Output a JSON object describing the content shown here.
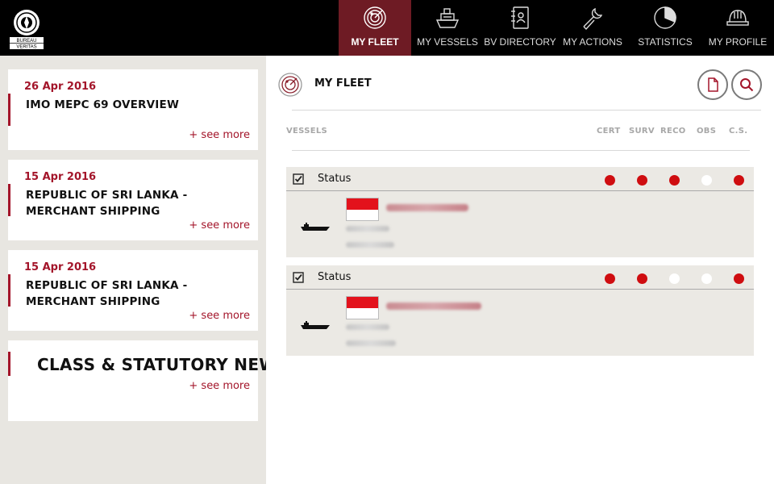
{
  "header": {
    "logo_lines": [
      "BUREAU",
      "VERITAS"
    ],
    "nav": [
      {
        "label": "MY FLEET",
        "icon": "radar-icon",
        "active": true
      },
      {
        "label": "MY VESSELS",
        "icon": "ship-icon",
        "active": false
      },
      {
        "label": "BV DIRECTORY",
        "icon": "contact-book-icon",
        "active": false
      },
      {
        "label": "MY ACTIONS",
        "icon": "wrench-icon",
        "active": false
      },
      {
        "label": "STATISTICS",
        "icon": "pie-chart-icon",
        "active": false
      },
      {
        "label": "MY PROFILE",
        "icon": "hard-hat-icon",
        "active": false
      }
    ]
  },
  "sidebar": {
    "news": [
      {
        "date": "26 Apr 2016",
        "title": "IMO MEPC 69 OVERVIEW",
        "more": "+ see more"
      },
      {
        "date": "15 Apr 2016",
        "title": "REPUBLIC OF SRI LANKA - MERCHANT SHIPPING SECRETARIAT - CIRCULAR ...",
        "more": "+ see more"
      },
      {
        "date": "15 Apr 2016",
        "title": "REPUBLIC OF SRI LANKA - MERCHANT SHIPPING SECRETARIAT - CIRCULAR ...",
        "more": "+ see more"
      }
    ],
    "class_news": {
      "title": "CLASS & STATUTORY NEWS",
      "more": "+ see more"
    }
  },
  "main": {
    "title": "MY FLEET",
    "columns": {
      "vessels": "VESSELS",
      "cert": "CERT",
      "surv": "SURV",
      "reco": "RECO",
      "obs": "OBS",
      "cs": "C.S."
    },
    "vessels": [
      {
        "status_label": "Status",
        "indicators": {
          "cert": "red",
          "surv": "red",
          "reco": "red",
          "obs": "white",
          "cs": "red"
        }
      },
      {
        "status_label": "Status",
        "indicators": {
          "cert": "red",
          "surv": "red",
          "reco": "white",
          "obs": "white",
          "cs": "red"
        }
      }
    ],
    "colors": {
      "accent": "#a3152a",
      "active_nav": "#6e1b24",
      "status_red": "#cf0d10"
    }
  }
}
